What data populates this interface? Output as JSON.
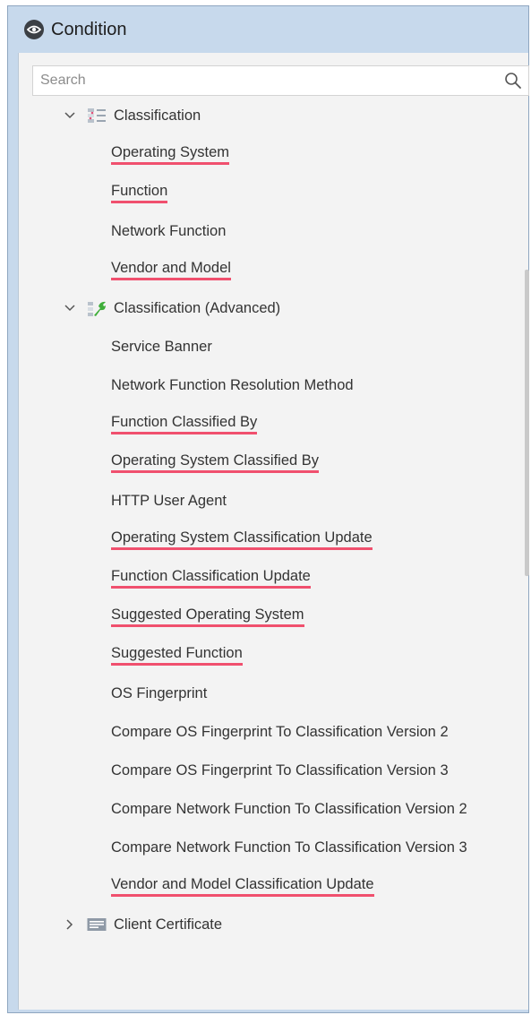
{
  "window": {
    "title": "Condition"
  },
  "search": {
    "placeholder": "Search"
  },
  "tree": {
    "classification": {
      "label": "Classification",
      "items": [
        {
          "label": "Operating System",
          "highlighted": true
        },
        {
          "label": "Function",
          "highlighted": true
        },
        {
          "label": "Network Function",
          "highlighted": false
        },
        {
          "label": "Vendor and Model",
          "highlighted": true
        }
      ]
    },
    "classification_advanced": {
      "label": "Classification (Advanced)",
      "items": [
        {
          "label": "Service Banner",
          "highlighted": false
        },
        {
          "label": "Network Function Resolution Method",
          "highlighted": false
        },
        {
          "label": "Function Classified By",
          "highlighted": true
        },
        {
          "label": "Operating System Classified By",
          "highlighted": true
        },
        {
          "label": "HTTP User Agent",
          "highlighted": false
        },
        {
          "label": "Operating System Classification Update",
          "highlighted": true
        },
        {
          "label": "Function Classification Update",
          "highlighted": true
        },
        {
          "label": "Suggested Operating System",
          "highlighted": true
        },
        {
          "label": "Suggested Function",
          "highlighted": true
        },
        {
          "label": "OS Fingerprint",
          "highlighted": false
        },
        {
          "label": "Compare OS Fingerprint To Classification Version 2",
          "highlighted": false
        },
        {
          "label": "Compare OS Fingerprint To Classification Version 3",
          "highlighted": false
        },
        {
          "label": "Compare Network Function To Classification Version 2",
          "highlighted": false
        },
        {
          "label": "Compare Network Function To Classification Version 3",
          "highlighted": false
        },
        {
          "label": "Vendor and Model Classification Update",
          "highlighted": true
        }
      ]
    },
    "client_certificate": {
      "label": "Client Certificate"
    }
  },
  "colors": {
    "highlight_underline": "#f0506e",
    "panel_background": "#f3f3f3",
    "window_frame": "#c7d9ec"
  }
}
